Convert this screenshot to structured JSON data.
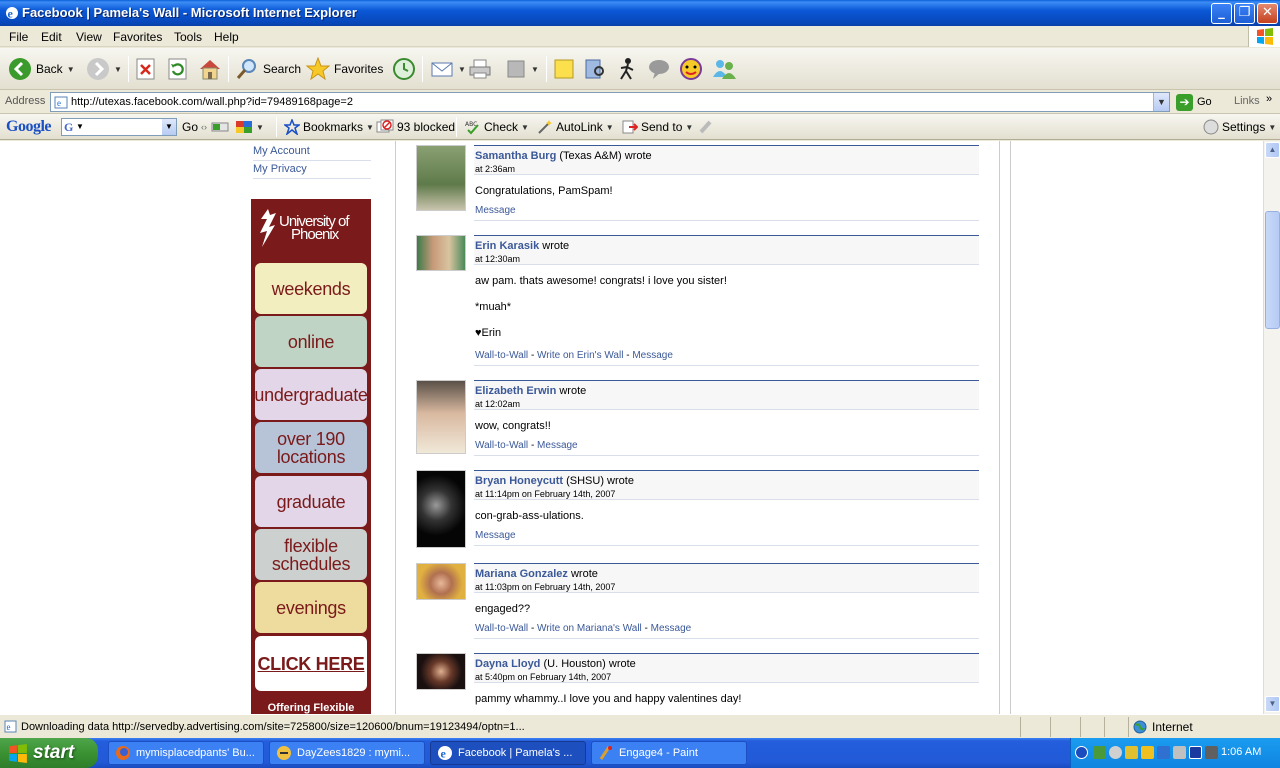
{
  "window": {
    "title": "Facebook | Pamela's Wall - Microsoft Internet Explorer"
  },
  "menu": [
    "File",
    "Edit",
    "View",
    "Favorites",
    "Tools",
    "Help"
  ],
  "toolbar": {
    "back": "Back",
    "search": "Search",
    "favorites": "Favorites"
  },
  "address": {
    "label": "Address",
    "url": "http://utexas.facebook.com/wall.php?id=79489168page=2",
    "go": "Go",
    "links": "Links"
  },
  "google": {
    "logo": "Google",
    "go": "Go",
    "bookmarks": "Bookmarks",
    "blocked": "93 blocked",
    "check": "Check",
    "autolink": "AutoLink",
    "sendto": "Send to",
    "settings": "Settings"
  },
  "sidebar": {
    "links": [
      "My Account",
      "My Privacy"
    ]
  },
  "ad": {
    "brand_line1": "University of",
    "brand_line2": "Phoenix",
    "items": [
      {
        "label": "weekends",
        "color": "#f3eec0"
      },
      {
        "label": "online",
        "color": "#bfd4c4"
      },
      {
        "label": "undergraduate",
        "color": "#e2d6e8"
      },
      {
        "label": "over 190 locations",
        "color": "#b7c4d8"
      },
      {
        "label": "graduate",
        "color": "#e2d6e8"
      },
      {
        "label": "flexible schedules",
        "color": "#ccd0cf"
      },
      {
        "label": "evenings",
        "color": "#eddc9e"
      }
    ],
    "cta": "CLICK HERE",
    "footer": "Offering Flexible"
  },
  "posts": [
    {
      "author": "Samantha Burg",
      "aff": "(Texas A&M)",
      "wrote": "wrote",
      "time": "at 2:36am",
      "body": [
        "Congratulations, PamSpam!"
      ],
      "actions": [
        "Message"
      ]
    },
    {
      "author": "Erin Karasik",
      "aff": "",
      "wrote": "wrote",
      "time": "at 12:30am",
      "body": [
        "aw pam. thats awesome! congrats! i love you sister!",
        "*muah*",
        "♥Erin"
      ],
      "actions": [
        "Wall-to-Wall",
        "Write on Erin's Wall",
        "Message"
      ]
    },
    {
      "author": "Elizabeth Erwin",
      "aff": "",
      "wrote": "wrote",
      "time": "at 12:02am",
      "body": [
        "wow, congrats!!"
      ],
      "actions": [
        "Wall-to-Wall",
        "Message"
      ]
    },
    {
      "author": "Bryan Honeycutt",
      "aff": "(SHSU)",
      "wrote": "wrote",
      "time": "at 11:14pm on February 14th, 2007",
      "body": [
        "con-grab-ass-ulations."
      ],
      "actions": [
        "Message"
      ]
    },
    {
      "author": "Mariana Gonzalez",
      "aff": "",
      "wrote": "wrote",
      "time": "at 11:03pm on February 14th, 2007",
      "body": [
        "engaged??"
      ],
      "actions": [
        "Wall-to-Wall",
        "Write on Mariana's Wall",
        "Message"
      ]
    },
    {
      "author": "Dayna Lloyd",
      "aff": "(U. Houston)",
      "wrote": "wrote",
      "time": "at 5:40pm on February 14th, 2007",
      "body": [
        "pammy whammy..I love you and happy valentines day!"
      ],
      "actions": []
    }
  ],
  "status": {
    "text": "Downloading data http://servedby.advertising.com/site=725800/size=120600/bnum=19123494/optn=1...",
    "zone": "Internet"
  },
  "taskbar": {
    "start": "start",
    "tasks": [
      "mymisplacedpants' Bu...",
      "DayZees1829 : mymi...",
      "Facebook | Pamela's ...",
      "Engage4 - Paint"
    ],
    "clock": "1:06 AM"
  }
}
